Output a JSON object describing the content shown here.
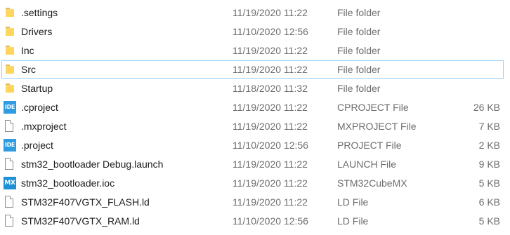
{
  "files": [
    {
      "name": ".settings",
      "date": "11/19/2020 11:22",
      "type": "File folder",
      "size": "",
      "icon": "folder-icon"
    },
    {
      "name": "Drivers",
      "date": "11/10/2020 12:56",
      "type": "File folder",
      "size": "",
      "icon": "folder-icon"
    },
    {
      "name": "Inc",
      "date": "11/19/2020 11:22",
      "type": "File folder",
      "size": "",
      "icon": "folder-icon"
    },
    {
      "name": "Src",
      "date": "11/19/2020 11:22",
      "type": "File folder",
      "size": "",
      "icon": "folder-icon",
      "selected": true
    },
    {
      "name": "Startup",
      "date": "11/18/2020 11:32",
      "type": "File folder",
      "size": "",
      "icon": "folder-icon"
    },
    {
      "name": ".cproject",
      "date": "11/19/2020 11:22",
      "type": "CPROJECT File",
      "size": "26 KB",
      "icon": "ide-icon"
    },
    {
      "name": ".mxproject",
      "date": "11/19/2020 11:22",
      "type": "MXPROJECT File",
      "size": "7 KB",
      "icon": "file-icon"
    },
    {
      "name": ".project",
      "date": "11/10/2020 12:56",
      "type": "PROJECT File",
      "size": "2 KB",
      "icon": "ide-icon"
    },
    {
      "name": "stm32_bootloader Debug.launch",
      "date": "11/19/2020 11:22",
      "type": "LAUNCH File",
      "size": "9 KB",
      "icon": "file-icon"
    },
    {
      "name": "stm32_bootloader.ioc",
      "date": "11/19/2020 11:22",
      "type": "STM32CubeMX",
      "size": "5 KB",
      "icon": "mx-icon"
    },
    {
      "name": "STM32F407VGTX_FLASH.ld",
      "date": "11/19/2020 11:22",
      "type": "LD File",
      "size": "6 KB",
      "icon": "file-icon"
    },
    {
      "name": "STM32F407VGTX_RAM.ld",
      "date": "11/10/2020 12:56",
      "type": "LD File",
      "size": "5 KB",
      "icon": "file-icon"
    }
  ],
  "badges": {
    "ide": "IDE",
    "mx": "MX"
  },
  "colors": {
    "folder": "#f8d775",
    "badge": "#2f9be0",
    "selection_border": "#99d1ff",
    "secondary_text": "#6d6d6d"
  }
}
